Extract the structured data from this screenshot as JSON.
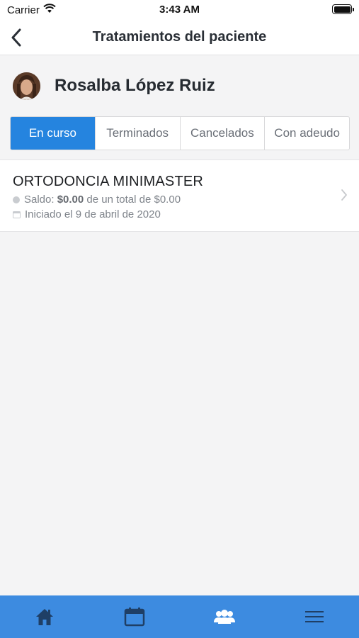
{
  "status_bar": {
    "carrier": "Carrier",
    "time": "3:43 AM",
    "battery_level": 1.0
  },
  "nav": {
    "title": "Tratamientos del paciente",
    "back_icon": "chevron-left-icon"
  },
  "patient": {
    "name": "Rosalba López Ruiz"
  },
  "tabs": [
    {
      "label": "En curso",
      "active": true
    },
    {
      "label": "Terminados",
      "active": false
    },
    {
      "label": "Cancelados",
      "active": false
    },
    {
      "label": "Con adeudo",
      "active": false
    }
  ],
  "treatments": [
    {
      "title": "ORTODONCIA MINIMASTER",
      "balance_prefix": "Saldo: ",
      "balance": "$0.00",
      "balance_suffix": " de un total de $0.00",
      "started": "Iniciado el 9 de abril de 2020"
    }
  ],
  "bottom_tabs": [
    {
      "icon": "home-icon"
    },
    {
      "icon": "calendar-icon"
    },
    {
      "icon": "patients-icon"
    },
    {
      "icon": "menu-icon"
    }
  ],
  "colors": {
    "accent": "#2584df",
    "tab_bar": "#3d8be0",
    "tab_bar_icon": "#1f3f66",
    "background": "#f4f4f5"
  }
}
